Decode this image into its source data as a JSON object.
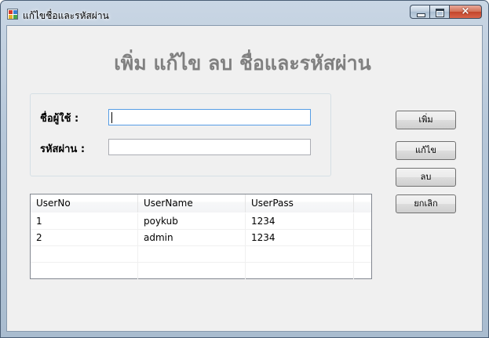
{
  "window": {
    "title": "แก้ไขชื่อและรหัสผ่าน",
    "icon": "app-icon",
    "controls": {
      "minimize": "minimize-icon",
      "maximize": "maximize-icon",
      "close": "×"
    }
  },
  "form": {
    "heading": "เพิ่ม แก้ไข ลบ ชื่อและรหัสผ่าน",
    "username_label": "ชื่อผู้ใช้ :",
    "username_value": "",
    "password_label": "รหัสผ่าน :",
    "password_value": ""
  },
  "buttons": {
    "add": "เพิ่ม",
    "edit": "แก้ไข",
    "delete": "ลบ",
    "cancel": "ยกเลิก"
  },
  "grid": {
    "columns": [
      "UserNo",
      "UserName",
      "UserPass"
    ],
    "rows": [
      [
        "1",
        "poykub",
        "1234"
      ],
      [
        "2",
        "admin",
        "1234"
      ]
    ]
  },
  "colors": {
    "heading": "#808080",
    "client_background": "#f0f0f0",
    "input_focus_border": "#569de5"
  }
}
